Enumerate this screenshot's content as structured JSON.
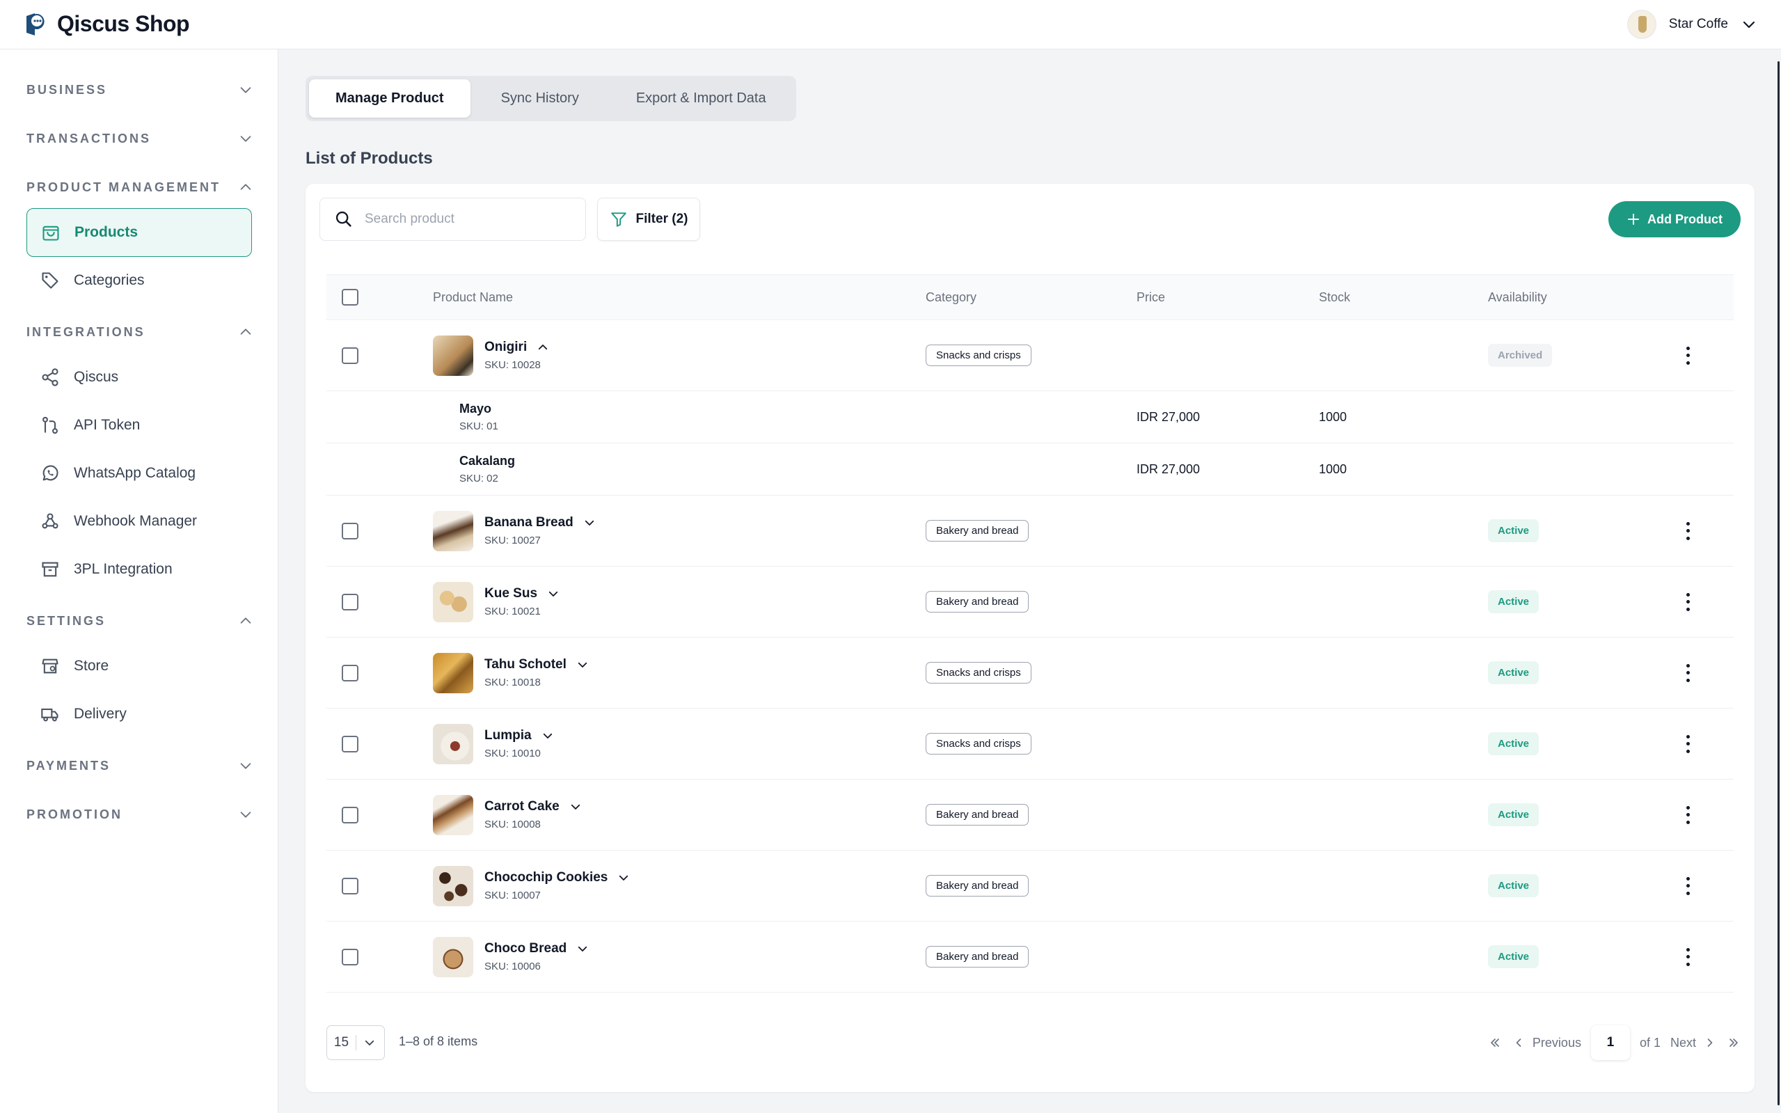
{
  "app": {
    "title": "Qiscus Shop"
  },
  "user": {
    "name": "Star Coffe"
  },
  "colors": {
    "accent": "#1d9a82",
    "accent_bg": "#ecf8f5"
  },
  "sidebar": {
    "sections": [
      {
        "label": "BUSINESS"
      },
      {
        "label": "TRANSACTIONS"
      },
      {
        "label": "PRODUCT MANAGEMENT"
      },
      {
        "label": "INTEGRATIONS"
      },
      {
        "label": "SETTINGS"
      },
      {
        "label": "PAYMENTS"
      },
      {
        "label": "PROMOTION"
      }
    ],
    "items": [
      {
        "label": "Products",
        "icon": "shopping-bag-icon"
      },
      {
        "label": "Categories",
        "icon": "tag-icon"
      },
      {
        "label": "Qiscus",
        "icon": "share-icon"
      },
      {
        "label": "API Token",
        "icon": "git-pull-icon"
      },
      {
        "label": "WhatsApp Catalog",
        "icon": "whatsapp-icon"
      },
      {
        "label": "Webhook Manager",
        "icon": "webhook-icon"
      },
      {
        "label": "3PL Integration",
        "icon": "archive-icon"
      },
      {
        "label": "Store",
        "icon": "store-icon"
      },
      {
        "label": "Delivery",
        "icon": "truck-icon"
      }
    ]
  },
  "tabs": [
    "Manage Product",
    "Sync History",
    "Export & Import Data"
  ],
  "main": {
    "list_title": "List of Products",
    "search_placeholder": "Search product",
    "filter_label": "Filter (2)",
    "add_label": "Add Product"
  },
  "table": {
    "headers": [
      "Product Name",
      "Category",
      "Price",
      "Stock",
      "Availability"
    ],
    "products": [
      {
        "name": "Onigiri",
        "sku": "SKU: 10028",
        "category": "Snacks and crisps",
        "availability": "Archived"
      },
      {
        "name": "Banana Bread",
        "sku": "SKU: 10027",
        "category": "Bakery and bread",
        "availability": "Active"
      },
      {
        "name": "Kue Sus",
        "sku": "SKU: 10021",
        "category": "Bakery and bread",
        "availability": "Active"
      },
      {
        "name": "Tahu Schotel",
        "sku": "SKU: 10018",
        "category": "Snacks and crisps",
        "availability": "Active"
      },
      {
        "name": "Lumpia",
        "sku": "SKU: 10010",
        "category": "Snacks and crisps",
        "availability": "Active"
      },
      {
        "name": "Carrot Cake",
        "sku": "SKU: 10008",
        "category": "Bakery and bread",
        "availability": "Active"
      },
      {
        "name": "Chocochip Cookies",
        "sku": "SKU: 10007",
        "category": "Bakery and bread",
        "availability": "Active"
      },
      {
        "name": "Choco Bread",
        "sku": "SKU: 10006",
        "category": "Bakery and bread",
        "availability": "Active"
      }
    ],
    "variants": [
      {
        "name": "Mayo",
        "sku": "SKU: 01",
        "price": "IDR 27,000",
        "stock": "1000"
      },
      {
        "name": "Cakalang",
        "sku": "SKU: 02",
        "price": "IDR 27,000",
        "stock": "1000"
      }
    ]
  },
  "footer": {
    "page_size": "15",
    "range": "1–8 of 8 items",
    "previous": "Previous",
    "current_page": "1",
    "of_pages": "of 1",
    "next": "Next"
  }
}
